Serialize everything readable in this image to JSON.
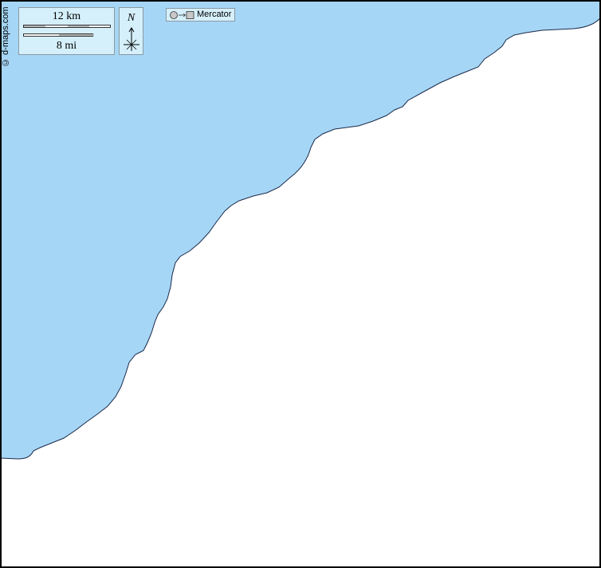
{
  "map": {
    "credit": "© d-maps.com",
    "scale": {
      "km_label": "12 km",
      "mi_label": "8 mi"
    },
    "north_label": "N",
    "projection_label": "Mercator",
    "colors": {
      "sea": "#a6d6f5",
      "land": "#ffffff",
      "coast": "#1a2a4a",
      "legend_bg": "#d5f0fb"
    }
  }
}
